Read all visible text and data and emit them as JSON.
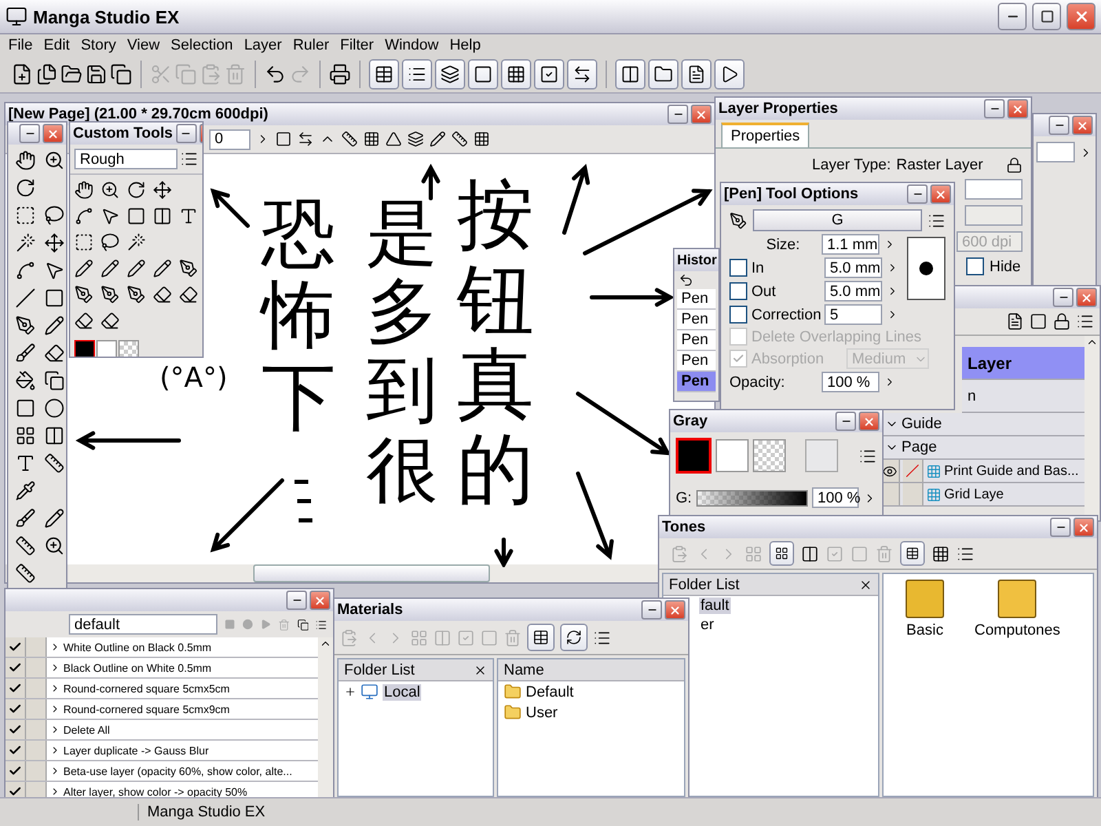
{
  "app": {
    "title": "Manga Studio EX"
  },
  "menu": [
    "File",
    "Edit",
    "Story",
    "View",
    "Selection",
    "Layer",
    "Ruler",
    "Filter",
    "Window",
    "Help"
  ],
  "document": {
    "title": "[New Page] (21.00 * 29.70cm 600dpi)",
    "zoom_value": "0",
    "handwriting": {
      "columns": [
        "恐怖下",
        "是多到很",
        "按钮真的"
      ],
      "kaomoji": "(°A°)"
    }
  },
  "custom_tools": {
    "title": "Custom Tools",
    "set": "Rough"
  },
  "layer_properties": {
    "title": "Layer Properties",
    "tabs": [
      {
        "label": "Properties",
        "selected": true
      }
    ],
    "type_label": "Layer Type:",
    "type_value": "Raster Layer",
    "resolution": "600 dpi",
    "hide": {
      "label": "Hide",
      "checked": false
    }
  },
  "pen_options": {
    "title": "[Pen] Tool Options",
    "brush": "G",
    "rows": [
      {
        "kind": "value",
        "label": "Size:",
        "value": "1.1 mm"
      },
      {
        "kind": "check",
        "label": "In",
        "checked": false,
        "disabled": false,
        "value": "5.0 mm"
      },
      {
        "kind": "check",
        "label": "Out",
        "checked": false,
        "disabled": false,
        "value": "5.0 mm"
      },
      {
        "kind": "check",
        "label": "Correction",
        "checked": false,
        "disabled": false,
        "value": "5"
      },
      {
        "kind": "check",
        "label": "Delete Overlapping Lines",
        "checked": false,
        "disabled": true
      },
      {
        "kind": "select",
        "label": "Absorption",
        "checked": true,
        "disabled": true,
        "value": "Medium"
      },
      {
        "kind": "value",
        "label": "Opacity:",
        "value": "100 %"
      }
    ]
  },
  "history": {
    "title": "Histor",
    "items": [
      {
        "label": "Pen",
        "selected": false
      },
      {
        "label": "Pen",
        "selected": false
      },
      {
        "label": "Pen",
        "selected": false
      },
      {
        "label": "Pen",
        "selected": false
      },
      {
        "label": "Pen",
        "selected": true
      }
    ]
  },
  "gray": {
    "title": "Gray",
    "channel": "G:",
    "level": 1,
    "value": "100 %"
  },
  "layers": {
    "rows": [
      {
        "kind": "header",
        "label": "Layer",
        "selected": true
      },
      {
        "kind": "header",
        "label": "n",
        "selected": false
      },
      {
        "kind": "folder",
        "label": "Guide",
        "selected": false
      },
      {
        "kind": "folder",
        "label": "Page",
        "selected": false
      },
      {
        "kind": "layer",
        "label": "Print Guide and Bas...",
        "selected": false,
        "visible": true
      },
      {
        "kind": "layer",
        "label": "Grid Laye",
        "selected": false,
        "visible": false
      }
    ]
  },
  "tones": {
    "title": "Tones",
    "folder_header": "Folder List",
    "folders": [
      {
        "label": "fault",
        "selected": true
      },
      {
        "label": "er",
        "selected": false
      }
    ],
    "items": [
      "Basic",
      "Computones"
    ]
  },
  "actions": {
    "set": "default",
    "items": [
      {
        "label": "White Outline on Black 0.5mm",
        "checked": true
      },
      {
        "label": "Black Outline on White 0.5mm",
        "checked": true
      },
      {
        "label": "Round-cornered square 5cmx5cm",
        "checked": true
      },
      {
        "label": "Round-cornered square 5cmx9cm",
        "checked": true
      },
      {
        "label": "Delete All",
        "checked": true
      },
      {
        "label": "Layer duplicate -> Gauss Blur",
        "checked": true
      },
      {
        "label": "Beta-use layer (opacity 60%, show color, alte...",
        "checked": true
      },
      {
        "label": "Alter layer, show color -> opacity 50%",
        "checked": true
      }
    ]
  },
  "materials": {
    "title": "Materials",
    "folder_header": "Folder List",
    "tree": [
      {
        "label": "Local",
        "expanded": false
      }
    ],
    "name_header": "Name",
    "items": [
      "Default",
      "User"
    ]
  },
  "status_bar": "Manga Studio EX"
}
